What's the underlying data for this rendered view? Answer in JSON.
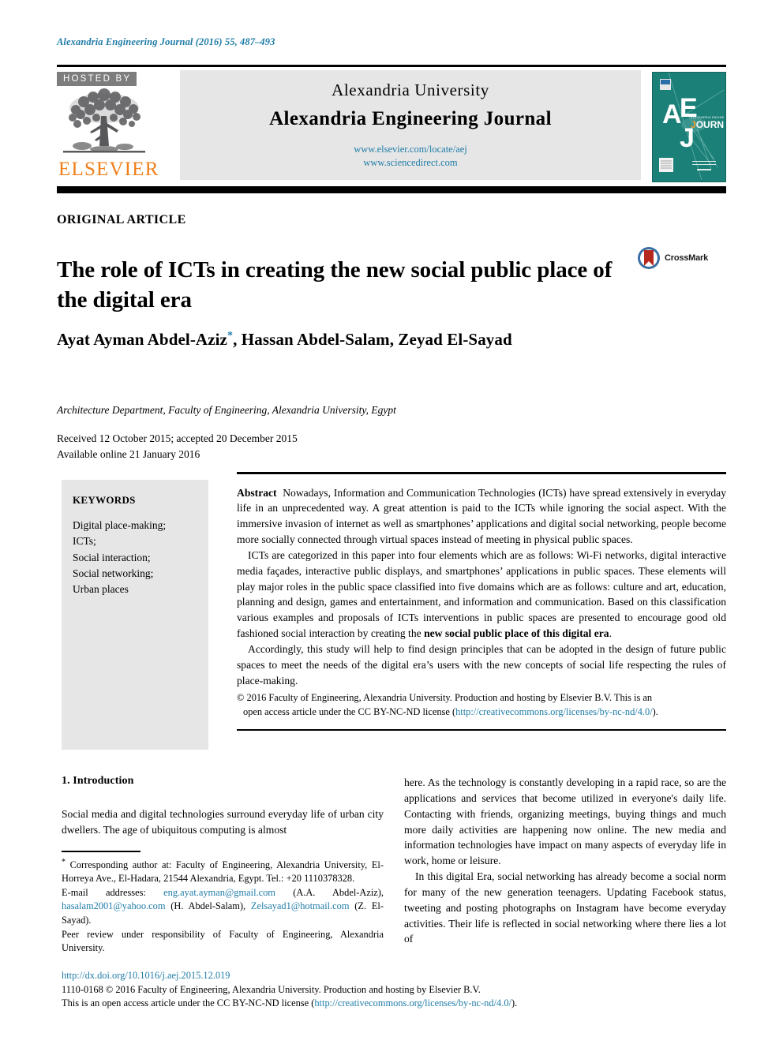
{
  "running_head": "Alexandria Engineering Journal (2016) 55, 487–493",
  "masthead": {
    "hosted_by": "HOSTED BY",
    "publisher": "ELSEVIER",
    "university": "Alexandria University",
    "journal_title": "Alexandria Engineering Journal",
    "url_locate": "www.elsevier.com/locate/aej",
    "url_sciencedirect": "www.sciencedirect.com",
    "cover": {
      "letters": "AEJ",
      "word": "JOURNAL",
      "small_title": "ALEXANDRIA ENGINEERING",
      "teal": "#1b8078"
    }
  },
  "article": {
    "type": "ORIGINAL ARTICLE",
    "title": "The role of ICTs in creating the new social public place of the digital era",
    "crossmark_label": "CrossMark",
    "authors": "Ayat Ayman Abdel-Aziz",
    "authors_rest": ", Hassan Abdel-Salam, Zeyad El-Sayad",
    "corresponding_marker": "*",
    "affiliation": "Architecture Department, Faculty of Engineering, Alexandria University, Egypt",
    "received": "Received 12 October 2015; accepted 20 December 2015",
    "available": "Available online 21 January 2016"
  },
  "keywords": {
    "title": "KEYWORDS",
    "items": [
      "Digital place-making;",
      "ICTs;",
      "Social interaction;",
      "Social networking;",
      "Urban places"
    ]
  },
  "abstract": {
    "label": "Abstract",
    "p1": "Nowadays, Information and Communication Technologies (ICTs) have spread extensively in everyday life in an unprecedented way. A great attention is paid to the ICTs while ignoring the social aspect. With the immersive invasion of internet as well as smartphones’ applications and digital social networking, people become more socially connected through virtual spaces instead of meeting in physical public spaces.",
    "p2_before": "ICTs are categorized in this paper into four elements which are as follows: Wi-Fi networks, digital interactive media façades, interactive public displays, and smartphones’ applications in public spaces. These elements will play major roles in the public space classified into five domains which are as follows: culture and art, education, planning and design, games and entertainment, and information and communication. Based on this classification various examples and proposals of ICTs interventions in public spaces are presented to encourage good old fashioned social interaction by creating the ",
    "p2_bold": "new social public place of this digital era",
    "p2_after": ".",
    "p3": "Accordingly, this study will help to find design principles that can be adopted in the design of future public spaces to meet the needs of the digital era’s users with the new concepts of social life respecting the rules of place-making.",
    "copyright_line1": "© 2016 Faculty of Engineering, Alexandria University. Production and hosting by Elsevier B.V. This is an",
    "copyright_line2_before": "open access article under the CC BY-NC-ND license (",
    "copyright_link": "http://creativecommons.org/licenses/by-nc-nd/4.0/",
    "copyright_line2_after": ")."
  },
  "introduction": {
    "heading": "1. Introduction",
    "p1": "Social media and digital technologies surround everyday life of urban city dwellers. The age of ubiquitous computing is almost",
    "p2": "here. As the technology is constantly developing in a rapid race, so are the applications and services that become utilized in everyone's daily life. Contacting with friends, organizing meetings, buying things and much more daily activities are happening now online. The new media and information technologies have impact on many aspects of everyday life in work, home or leisure.",
    "p3": "In this digital Era, social networking has already become a social norm for many of the new generation teenagers. Updating Facebook status, tweeting and posting photographs on Instagram have become everyday activities. Their life is reflected in social networking where there lies a lot of"
  },
  "footnote": {
    "corresponding": "Corresponding author at: Faculty of Engineering, Alexandria University, El-Horreya Ave., El-Hadara, 21544 Alexandria, Egypt. Tel.: +20 1110378328.",
    "email_label": "E-mail addresses:",
    "email1": "eng.ayat.ayman@gmail.com",
    "email1_owner": "(A.A. Abdel-Aziz),",
    "email2": "hasalam2001@yahoo.com",
    "email2_owner": "(H. Abdel-Salam),",
    "email3": "Zelsayad1@hotmail.com",
    "email3_owner": "(Z. El-Sayad).",
    "peer_review": "Peer review under responsibility of Faculty of Engineering, Alexandria University."
  },
  "footer": {
    "doi": "http://dx.doi.org/10.1016/j.aej.2015.12.019",
    "issn_line": "1110-0168 © 2016 Faculty of Engineering, Alexandria University. Production and hosting by Elsevier B.V.",
    "license_before": "This is an open access article under the CC BY-NC-ND license (",
    "license_link": "http://creativecommons.org/licenses/by-nc-nd/4.0/",
    "license_after": ")."
  }
}
